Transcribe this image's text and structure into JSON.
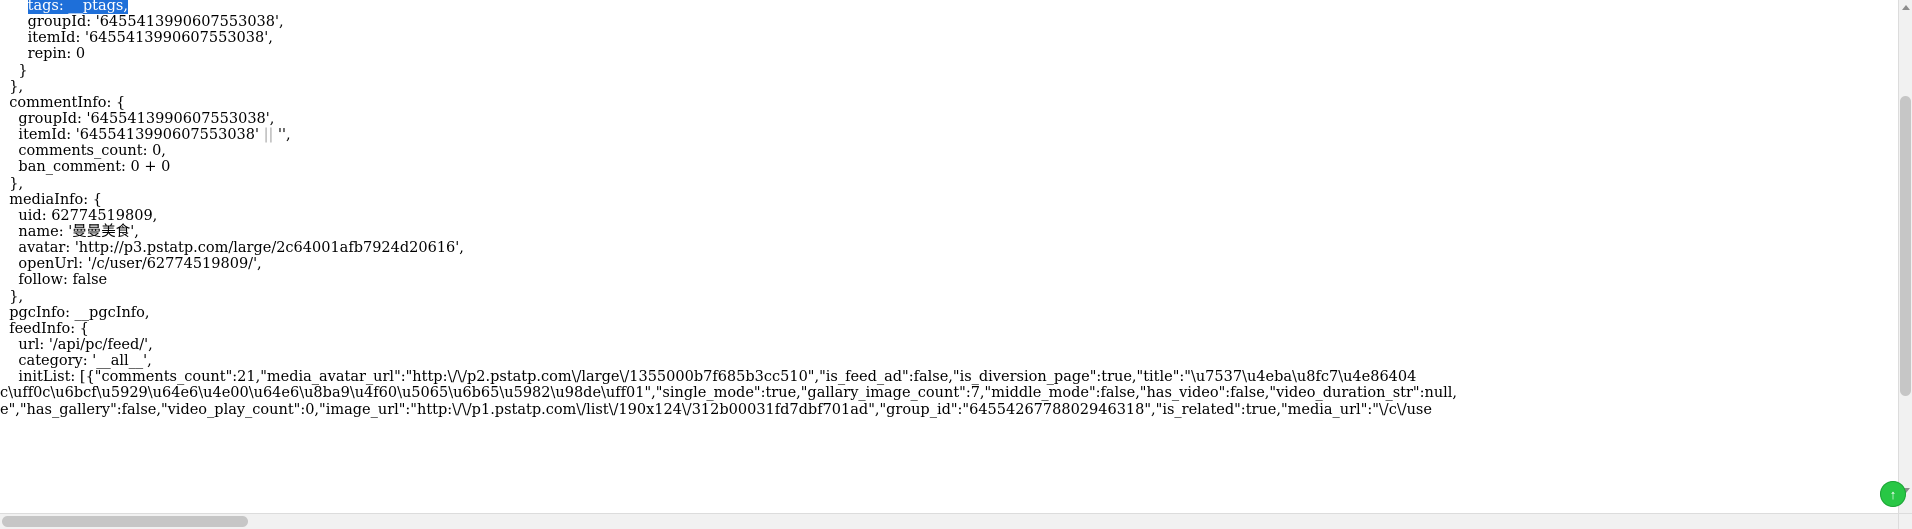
{
  "window": {
    "title": "view-source code listing",
    "background_color": "#ffffff",
    "text_color": "#000000",
    "selection_color": "#1e6fd9",
    "dim_color": "#a6a6a6"
  },
  "code": {
    "lines": [
      "      tags: __ptags,",
      "      groupId: '6455413990607553038',",
      "      itemId: '6455413990607553038',",
      "      repin: 0",
      "    }",
      "  },",
      "  commentInfo: {",
      "    groupId: '6455413990607553038',",
      "    itemId: '6455413990607553038' || '',",
      "    comments_count: 0,",
      "    ban_comment: 0 + 0",
      "  },",
      "  mediaInfo: {",
      "    uid: 62774519809,",
      "    name: '曼曼美食',",
      "    avatar: 'http://p3.pstatp.com/large/2c64001afb7924d20616',",
      "    openUrl: '/c/user/62774519809/',",
      "    follow: false",
      "  },",
      "  pgcInfo: __pgcInfo,",
      "  feedInfo: {",
      "    url: '/api/pc/feed/',",
      "    category: '__all__',",
      "    initList: [{\"comments_count\":21,\"media_avatar_url\":\"http:\\/\\/p2.pstatp.com\\/large\\/1355000b7f685b3cc510\",\"is_feed_ad\":false,\"is_diversion_page\":true,\"title\":\"\\u7537\\u4eba\\u8fc7\\u4e86404",
      "c\\uff0c\\u6bcf\\u5929\\u64e6\\u4e00\\u64e6\\u8ba9\\u4f60\\u5065\\u6b65\\u5982\\u98de\\uff01\",\"single_mode\":true,\"gallary_image_count\":7,\"middle_mode\":false,\"has_video\":false,\"video_duration_str\":null,",
      "e\",\"has_gallery\":false,\"video_play_count\":0,\"image_url\":\"http:\\/\\/p1.pstatp.com\\/list\\/190x124\\/312b00031fd7dbf701ad\",\"group_id\":\"6455426778802946318\",\"is_related\":true,\"media_url\":\"\\/c\\/use"
    ],
    "selected_line_index": 0,
    "selected_line_text": "tags: __ptags,",
    "dim_tokens": [
      "||"
    ]
  },
  "scrollbars": {
    "vertical": {
      "name": "vertical-scrollbar",
      "thumb_position_pct": 19,
      "thumb_size_pct": 60
    },
    "horizontal": {
      "name": "horizontal-scrollbar",
      "thumb_position_pct": 0,
      "thumb_size_pct": 13
    }
  },
  "overlay": {
    "green_badge_glyph": "↑"
  }
}
